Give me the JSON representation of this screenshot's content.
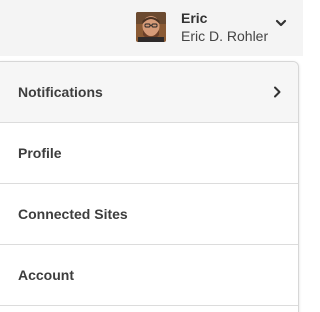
{
  "user": {
    "first_name": "Eric",
    "full_name": "Eric D. Rohler",
    "avatar_icon": "user-avatar-photo"
  },
  "menu": {
    "items": [
      {
        "label": "Notifications",
        "has_submenu": true
      },
      {
        "label": "Profile"
      },
      {
        "label": "Connected Sites"
      },
      {
        "label": "Account"
      }
    ]
  },
  "colors": {
    "topbar_bg": "#f4f4f4",
    "active_item_bg": "#f6f6f6",
    "divider": "#dcdcdc",
    "text": "#3d3d3d"
  }
}
